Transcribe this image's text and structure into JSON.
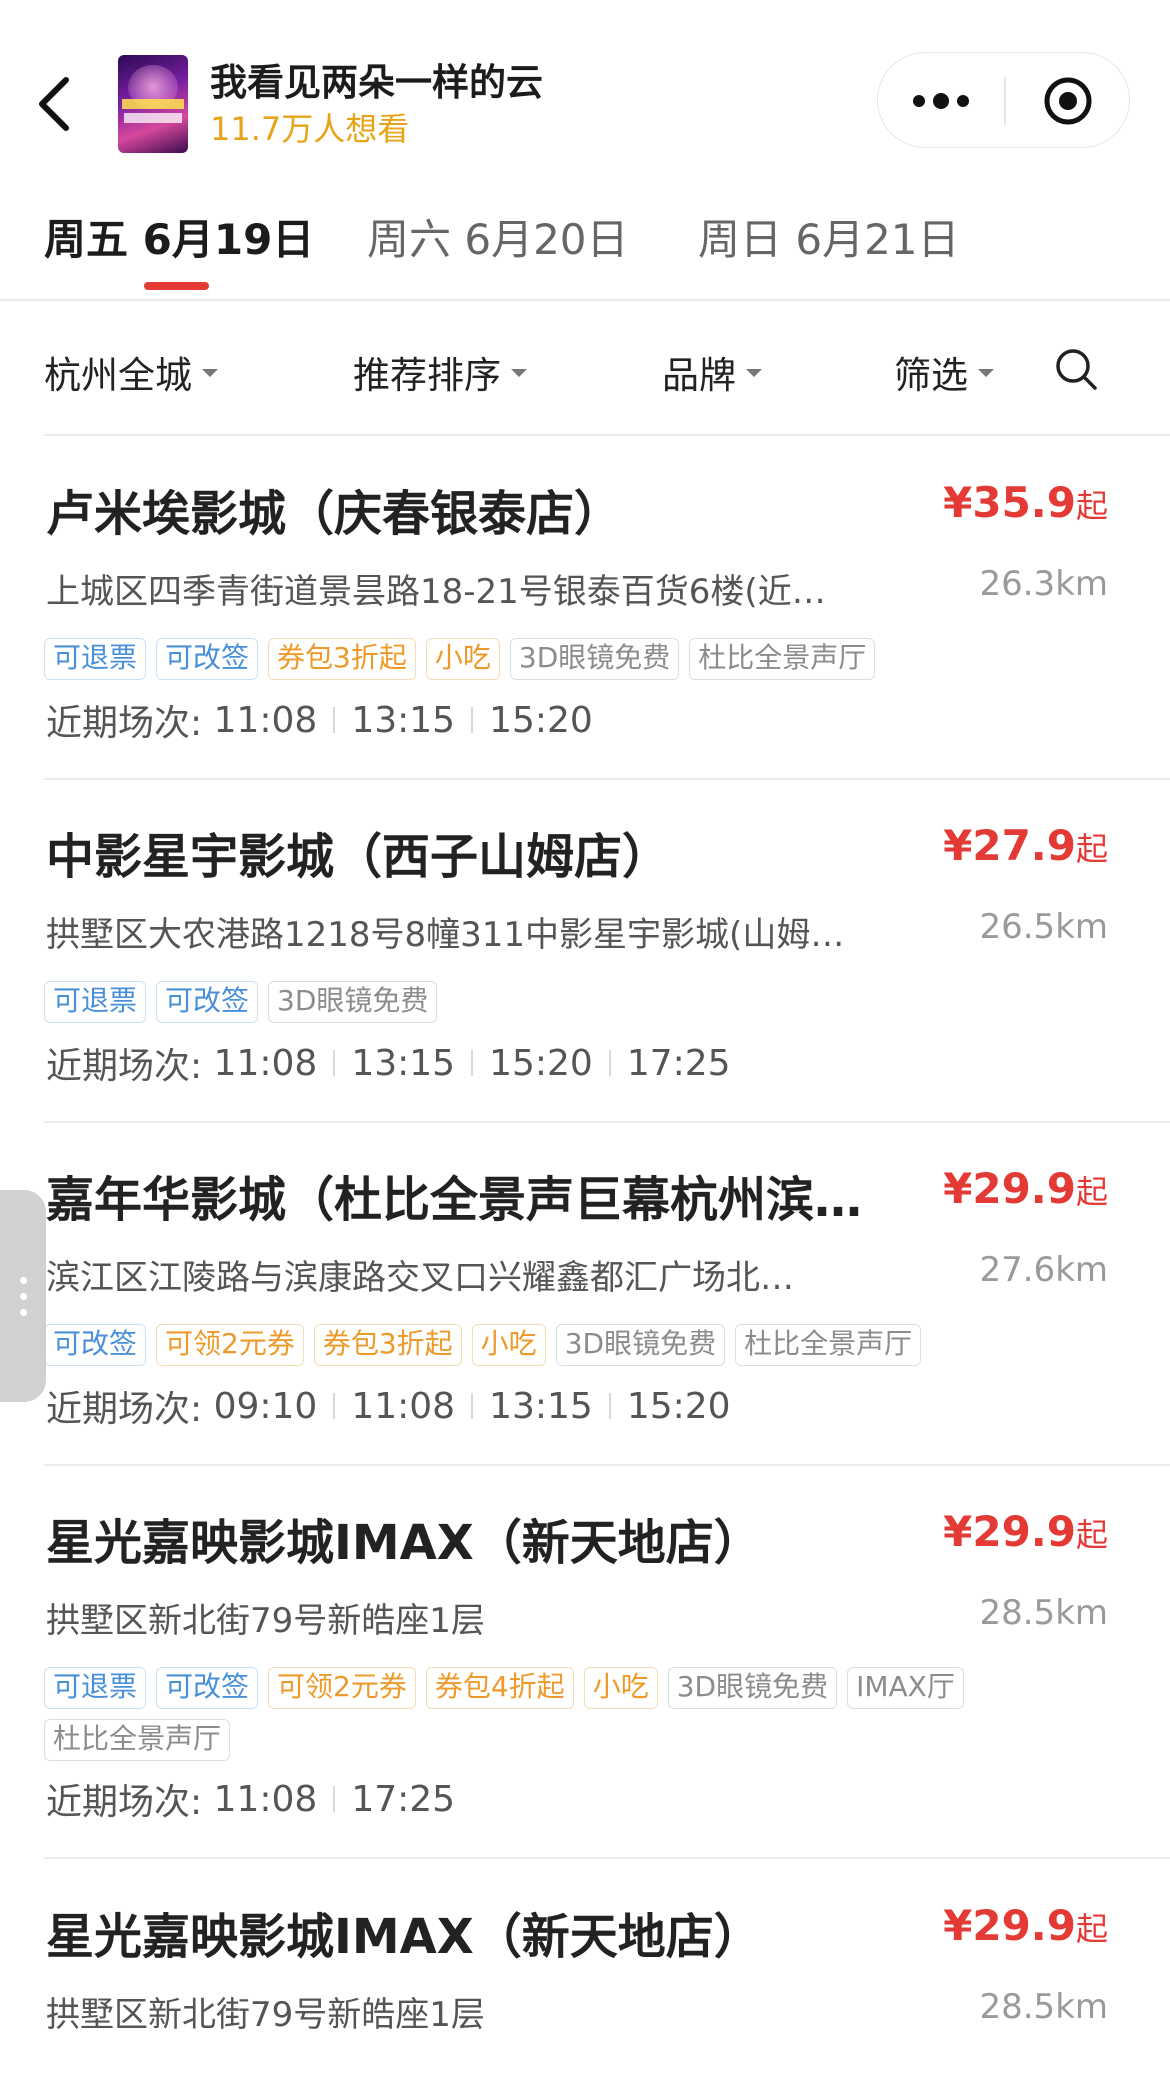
{
  "header": {
    "movie_title": "我看见两朵一样的云",
    "want_to_watch": "11.7万人想看",
    "icons": [
      "back-arrow-icon",
      "more-dots-icon",
      "close-target-icon"
    ]
  },
  "date_tabs": [
    {
      "label": "周五 6月19日",
      "active": true
    },
    {
      "label": "周六 6月20日",
      "active": false
    },
    {
      "label": "周日 6月21日",
      "active": false
    }
  ],
  "filters": {
    "city": "杭州全城",
    "sort": "推荐排序",
    "brand": "品牌",
    "filter": "筛选"
  },
  "colors": {
    "accent_red": "#e33a36",
    "want_yellow": "#e7a41a",
    "tag_blue": "#4a90d9",
    "tag_orange": "#ee9a2a",
    "tag_gray": "#8c8c8c"
  },
  "cinemas": [
    {
      "name": "卢米埃影城（庆春银泰店）",
      "price": "¥35.9",
      "price_suffix": "起",
      "address": "上城区四季青街道景昙路18-21号银泰百货6楼(近…",
      "distance": "26.3km",
      "tags": [
        {
          "text": "可退票",
          "style": "blue"
        },
        {
          "text": "可改签",
          "style": "blue"
        },
        {
          "text": "券包3折起",
          "style": "orange"
        },
        {
          "text": "小吃",
          "style": "orange"
        },
        {
          "text": "3D眼镜免费",
          "style": "gray"
        },
        {
          "text": "杜比全景声厅",
          "style": "gray"
        }
      ],
      "showtimes_label": "近期场次:",
      "showtimes": [
        "11:08",
        "13:15",
        "15:20"
      ]
    },
    {
      "name": "中影星宇影城（西子山姆店）",
      "price": "¥27.9",
      "price_suffix": "起",
      "address": "拱墅区大农港路1218号8幢311中影星宇影城(山姆…",
      "distance": "26.5km",
      "tags": [
        {
          "text": "可退票",
          "style": "blue"
        },
        {
          "text": "可改签",
          "style": "blue"
        },
        {
          "text": "3D眼镜免费",
          "style": "gray"
        }
      ],
      "showtimes_label": "近期场次:",
      "showtimes": [
        "11:08",
        "13:15",
        "15:20",
        "17:25"
      ]
    },
    {
      "name": "嘉年华影城（杜比全景声巨幕杭州滨…",
      "price": "¥29.9",
      "price_suffix": "起",
      "address": "滨江区江陵路与滨康路交叉口兴耀鑫都汇广场北…",
      "distance": "27.6km",
      "tags": [
        {
          "text": "可改签",
          "style": "blue"
        },
        {
          "text": "可领2元券",
          "style": "orange"
        },
        {
          "text": "券包3折起",
          "style": "orange"
        },
        {
          "text": "小吃",
          "style": "orange"
        },
        {
          "text": "3D眼镜免费",
          "style": "gray"
        },
        {
          "text": "杜比全景声厅",
          "style": "gray"
        }
      ],
      "showtimes_label": "近期场次:",
      "showtimes": [
        "09:10",
        "11:08",
        "13:15",
        "15:20"
      ]
    },
    {
      "name": "星光嘉映影城IMAX（新天地店）",
      "price": "¥29.9",
      "price_suffix": "起",
      "address": "拱墅区新北街79号新皓座1层",
      "distance": "28.5km",
      "tags": [
        {
          "text": "可退票",
          "style": "blue"
        },
        {
          "text": "可改签",
          "style": "blue"
        },
        {
          "text": "可领2元券",
          "style": "orange"
        },
        {
          "text": "券包4折起",
          "style": "orange"
        },
        {
          "text": "小吃",
          "style": "orange"
        },
        {
          "text": "3D眼镜免费",
          "style": "gray"
        },
        {
          "text": "IMAX厅",
          "style": "gray"
        },
        {
          "text": "杜比全景声厅",
          "style": "gray"
        }
      ],
      "showtimes_label": "近期场次:",
      "showtimes": [
        "11:08",
        "17:25"
      ]
    },
    {
      "name": "星光嘉映影城IMAX（新天地店）",
      "price": "¥29.9",
      "price_suffix": "起",
      "address": "拱墅区新北街79号新皓座1层",
      "distance": "28.5km",
      "tags": [],
      "showtimes_label": "",
      "showtimes": []
    }
  ]
}
